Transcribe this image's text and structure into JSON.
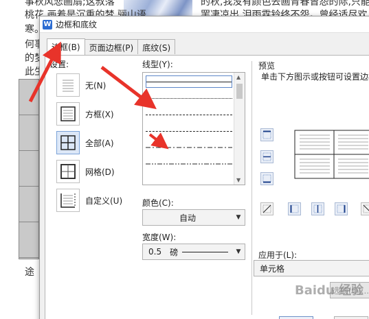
{
  "background_doc": {
    "lines": [
      "事秋风悲画扇;这叔落",
      "桃花,画着是沉重的梦,骊山语",
      "寒。",
      "何事",
      "的梦",
      "此生"
    ],
    "right_lines": [
      "的秋,我没有颜色去画青春曾怨的际,只能",
      "罢凄凉出,泪雨霖铃终不怨。曾经适尽欢"
    ],
    "bottom_char": "途"
  },
  "dialog": {
    "title": "边框和底纹",
    "app_icon": "W",
    "tabs": [
      {
        "label": "边框(B)",
        "active": true
      },
      {
        "label": "页面边框(P)",
        "active": false
      },
      {
        "label": "底纹(S)",
        "active": false
      }
    ],
    "settings": {
      "label": "设置:",
      "items": [
        {
          "label": "无(N)",
          "icon": "no-border-icon",
          "selected": false
        },
        {
          "label": "方框(X)",
          "icon": "box-border-icon",
          "selected": false
        },
        {
          "label": "全部(A)",
          "icon": "all-borders-icon",
          "selected": true
        },
        {
          "label": "网格(D)",
          "icon": "grid-borders-icon",
          "selected": false
        },
        {
          "label": "自定义(U)",
          "icon": "custom-border-icon",
          "selected": false
        }
      ]
    },
    "line_style": {
      "label": "线型(Y):",
      "styles": [
        "solid",
        "dotted",
        "dashed-fine",
        "dashed",
        "dash-dot",
        "dash-dot-dot"
      ]
    },
    "color": {
      "label": "颜色(C):",
      "value": "自动"
    },
    "width": {
      "label": "宽度(W):",
      "value": "0.5",
      "unit": "磅"
    },
    "preview": {
      "label": "预览",
      "hint": "单击下方图示或按钮可设置边框"
    },
    "apply_to": {
      "label": "应用于(L):",
      "value": "单元格"
    },
    "options_button": "选项(O)..."
  },
  "watermark": "Baidu 经验",
  "colors": {
    "accent": "#2d6dd2",
    "arrow_red": "#e8332a",
    "selected_bg": "#dce7f7"
  }
}
